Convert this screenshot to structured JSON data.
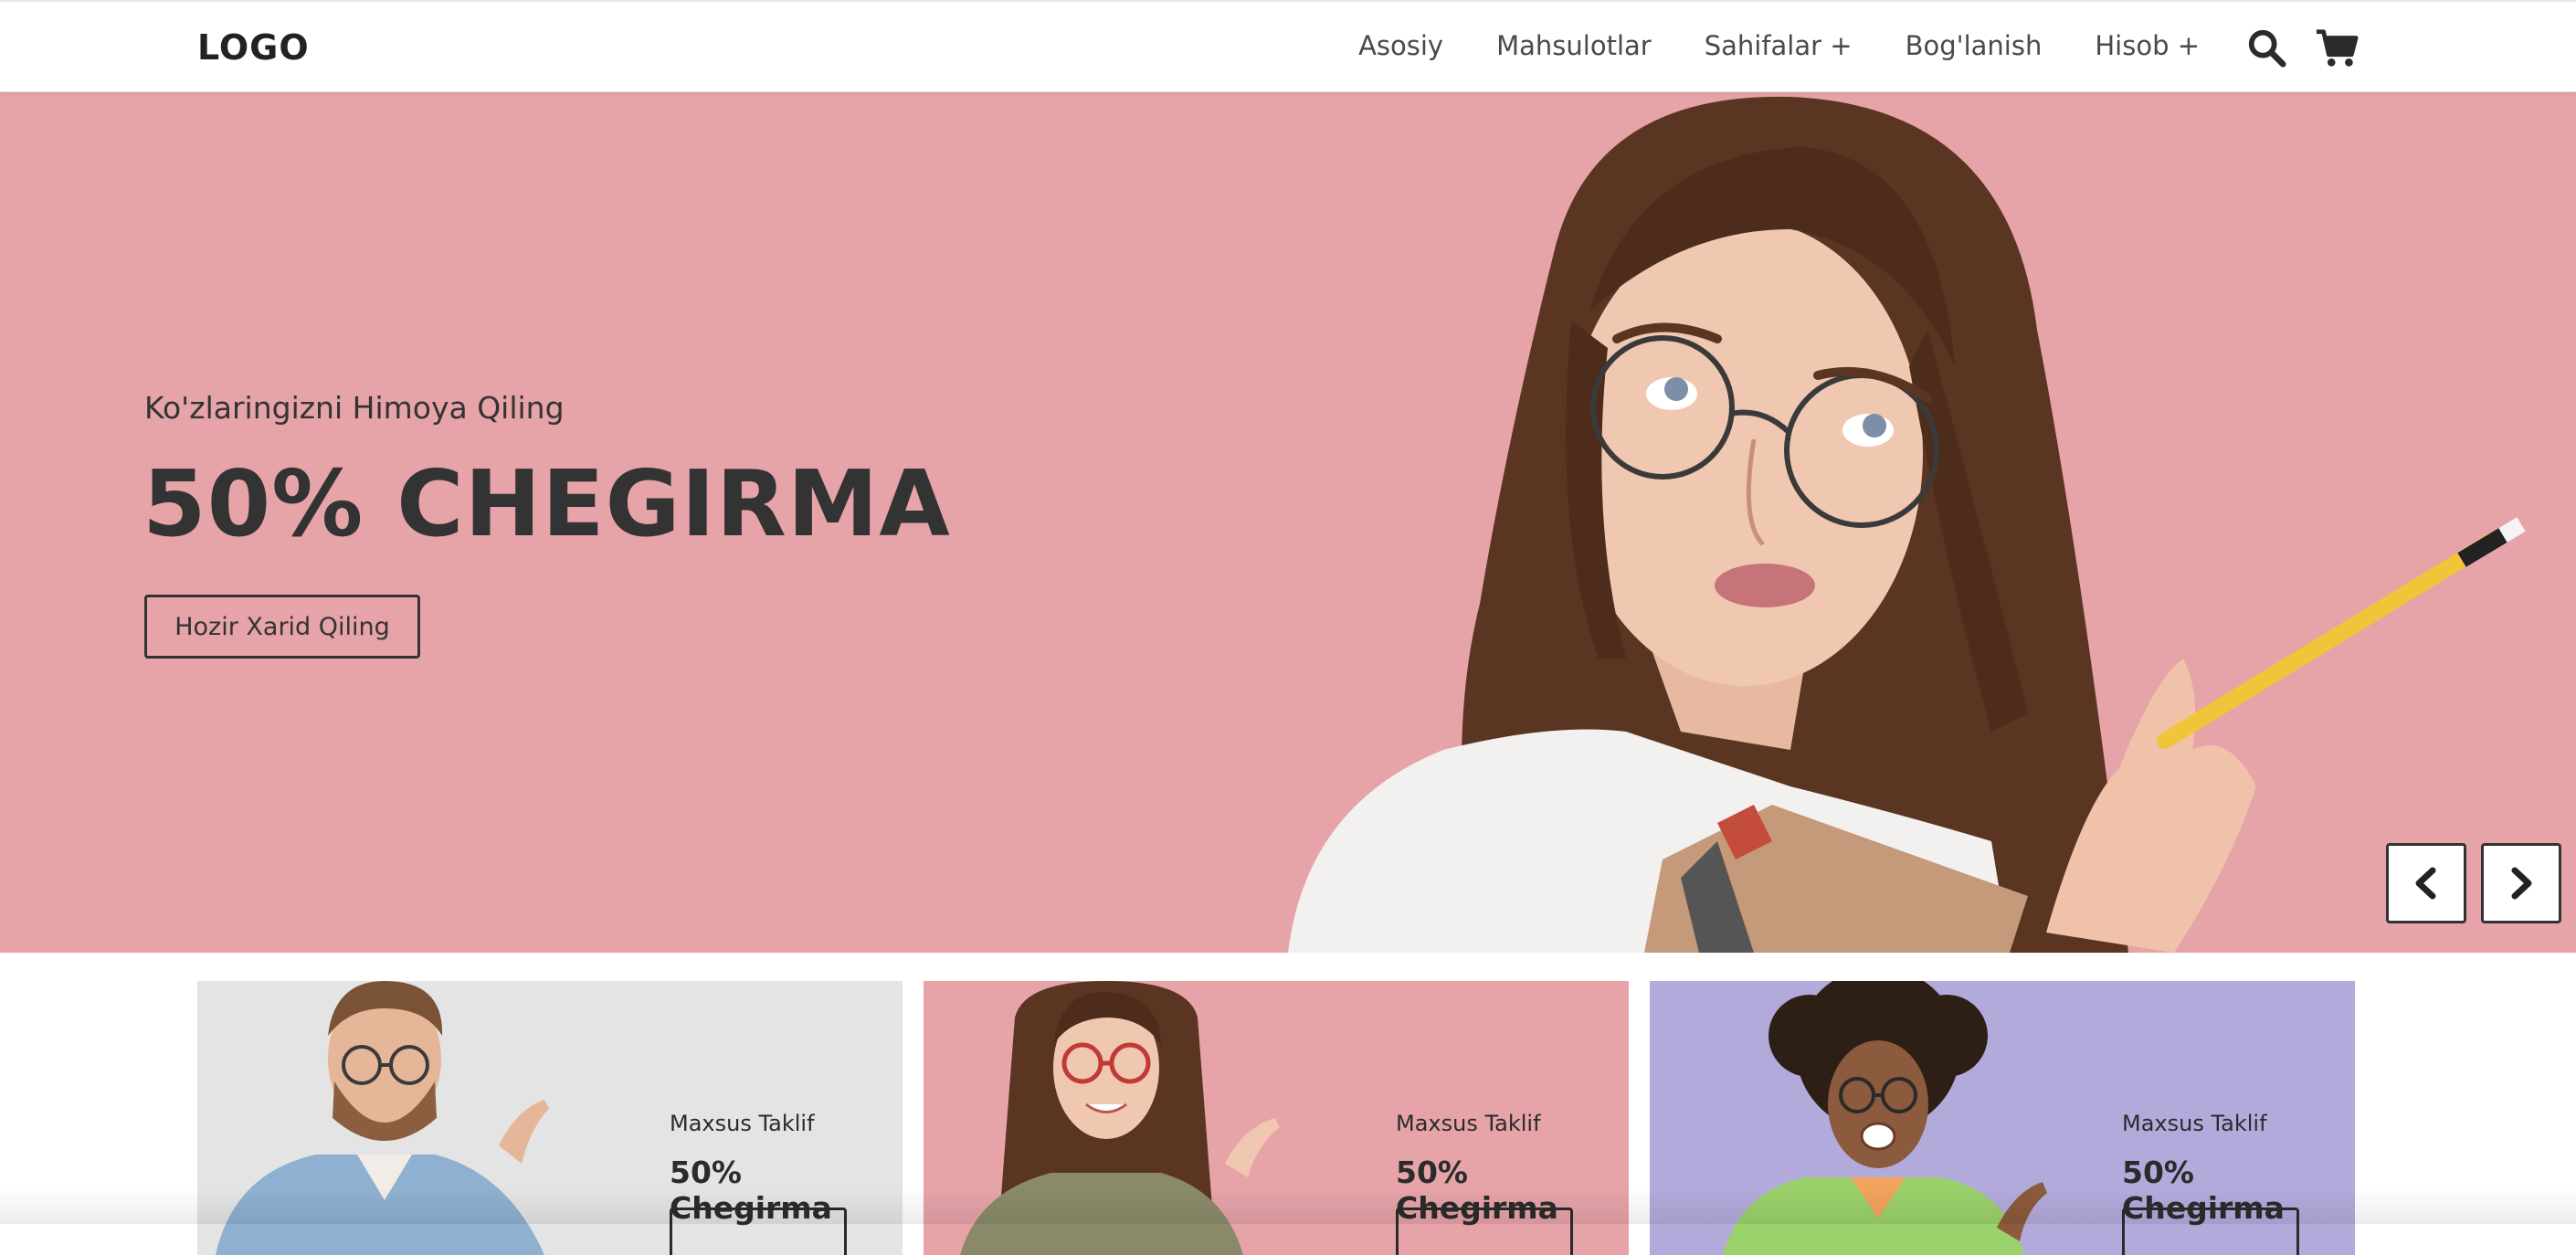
{
  "header": {
    "logo": "LOGO",
    "nav": [
      {
        "label": "Asosiy"
      },
      {
        "label": "Mahsulotlar"
      },
      {
        "label": "Sahifalar +"
      },
      {
        "label": "Bog'lanish"
      },
      {
        "label": "Hisob +"
      }
    ],
    "icons": {
      "search": "search-icon",
      "cart": "cart-icon"
    }
  },
  "hero": {
    "subtitle": "Ko'zlaringizni Himoya Qiling",
    "title": "50% CHEGIRMA",
    "button": "Hozir Xarid Qiling",
    "background": "#e6a3a8",
    "prev_icon": "chevron-left-icon",
    "next_icon": "chevron-right-icon"
  },
  "offers": [
    {
      "kicker": "Maxsus Taklif",
      "title": "50% Chegirma",
      "background": "#e4e4e4"
    },
    {
      "kicker": "Maxsus Taklif",
      "title": "50% Chegirma",
      "background": "#e6a3a8"
    },
    {
      "kicker": "Maxsus Taklif",
      "title": "50% Chegirma",
      "background": "#b3aadc"
    }
  ]
}
